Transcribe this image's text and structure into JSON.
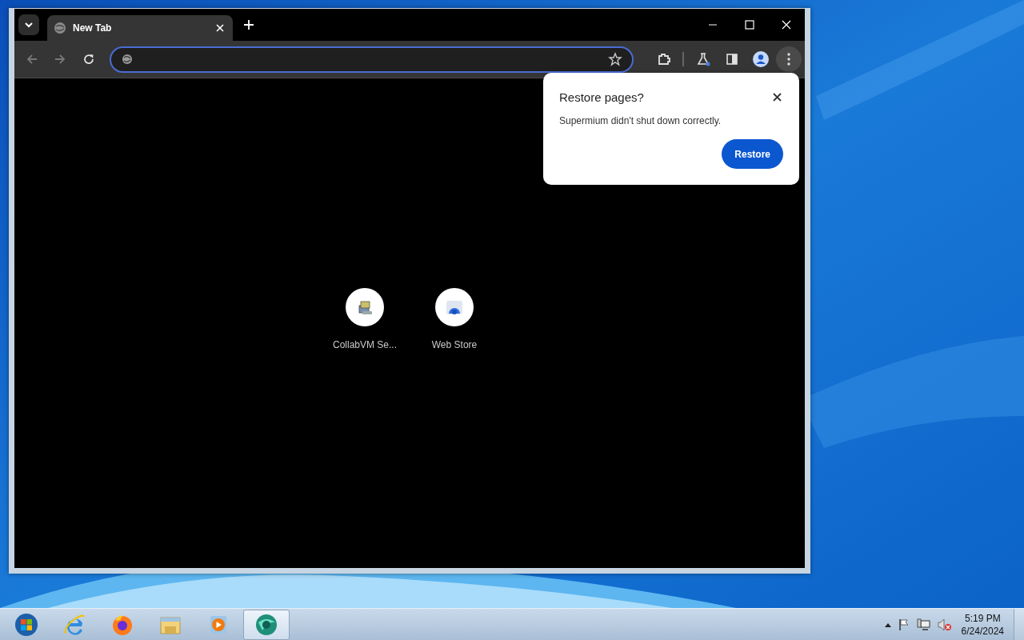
{
  "browser": {
    "tabs": [
      {
        "title": "New Tab",
        "selected": true
      }
    ],
    "address_bar": {
      "focused": true
    },
    "toolbar": {
      "back_disabled": true,
      "forward_disabled": true
    },
    "shortcuts": [
      {
        "label": "CollabVM Se...",
        "kind": "computer"
      },
      {
        "label": "Web Store",
        "kind": "store"
      }
    ],
    "restore_dialog": {
      "title": "Restore pages?",
      "message": "Supermium didn't shut down correctly.",
      "button": "Restore"
    }
  },
  "taskbar": {
    "apps": [
      {
        "kind": "start",
        "selected": false
      },
      {
        "kind": "ie",
        "selected": false
      },
      {
        "kind": "firefox",
        "selected": false
      },
      {
        "kind": "explorer",
        "selected": false
      },
      {
        "kind": "media",
        "selected": false
      },
      {
        "kind": "supermium",
        "selected": true
      }
    ],
    "clock": {
      "time": "5:19 PM",
      "date": "6/24/2024"
    }
  }
}
